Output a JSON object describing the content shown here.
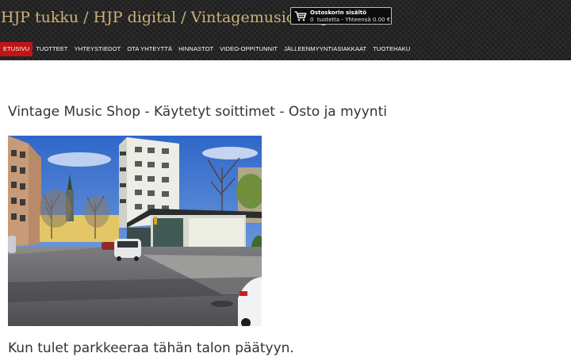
{
  "site": {
    "title": "HJP tukku / HJP digital / Vintagemusicshop"
  },
  "cart": {
    "title": "Ostoskorin sisältö",
    "count": "0",
    "count_label": "tuotetta",
    "total_label": "Yhteensä",
    "total": "0.00 €",
    "icon": "shopping-cart-icon"
  },
  "nav": {
    "items": [
      {
        "label": "ETUSIVU",
        "active": true
      },
      {
        "label": "TUOTTEET"
      },
      {
        "label": "YHTEYSTIEDOT"
      },
      {
        "label": "OTA YHTEYTTÄ"
      },
      {
        "label": "HINNASTOT"
      },
      {
        "label": "VIDEO-OPPITUNNIT"
      },
      {
        "label": "JÄLLEENMYYNTIASIAKKAAT"
      },
      {
        "label": "TUOTEHAKU"
      }
    ]
  },
  "content": {
    "heading": "Vintage Music Shop - Käytetyt soittimet - Osto ja myynti",
    "subheading": "Kun tulet parkkeeraa tähän talon päätyyn."
  },
  "colors": {
    "header_bg": "#1f1f1f",
    "title": "#cfb27a",
    "nav_active": "#c01515",
    "text": "#333333"
  }
}
